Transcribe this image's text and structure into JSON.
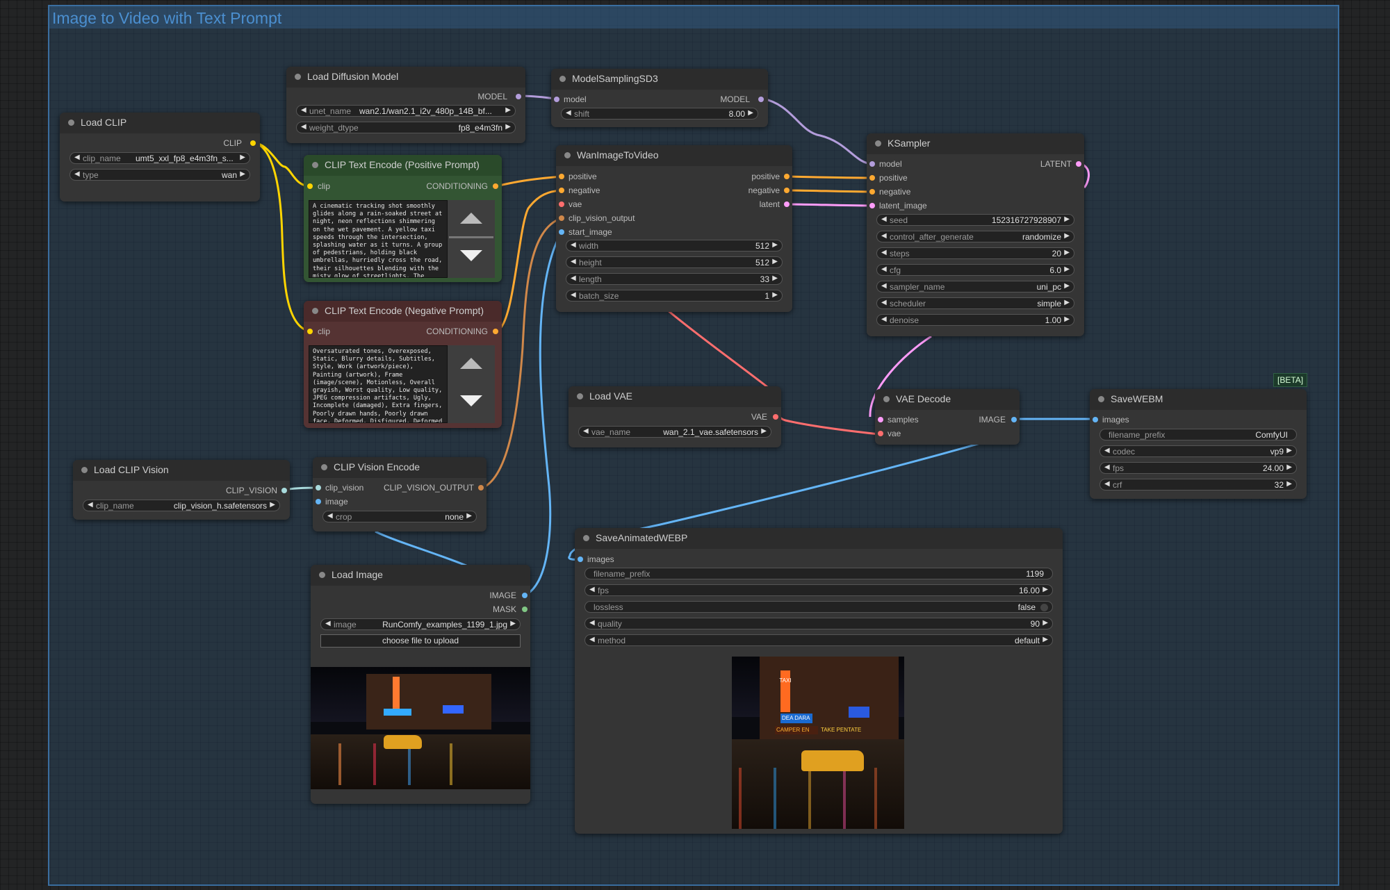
{
  "group": {
    "title": "Image to Video with Text Prompt"
  },
  "nodes": {
    "load_diffusion_model": {
      "title": "Load Diffusion Model",
      "out": "MODEL",
      "widgets": [
        {
          "label": "unet_name",
          "value": "wan2.1/wan2.1_i2v_480p_14B_bf..."
        },
        {
          "label": "weight_dtype",
          "value": "fp8_e4m3fn"
        }
      ]
    },
    "model_sampling": {
      "title": "ModelSamplingSD3",
      "in": "model",
      "out": "MODEL",
      "widgets": [
        {
          "label": "shift",
          "value": "8.00"
        }
      ]
    },
    "load_clip": {
      "title": "Load CLIP",
      "out": "CLIP",
      "widgets": [
        {
          "label": "clip_name",
          "value": "umt5_xxl_fp8_e4m3fn_s..."
        },
        {
          "label": "type",
          "value": "wan"
        }
      ]
    },
    "clip_pos": {
      "title": "CLIP Text Encode (Positive Prompt)",
      "in": "clip",
      "out": "CONDITIONING",
      "text": "A cinematic tracking shot smoothly glides along a rain-soaked street at night, neon reflections shimmering on the wet pavement. A yellow taxi speeds through the intersection, splashing water as it turns. A group of pedestrians, holding black umbrellas, hurriedly cross the road, their silhouettes blending with the misty glow of streetlights. The camera"
    },
    "clip_neg": {
      "title": "CLIP Text Encode (Negative Prompt)",
      "in": "clip",
      "out": "CONDITIONING",
      "text": "Oversaturated tones, Overexposed, Static, Blurry details, Subtitles, Style, Work (artwork/piece), Painting (artwork), Frame (image/scene), Motionless, Overall grayish, Worst quality, Low quality, JPEG compression artifacts, Ugly, Incomplete (damaged), Extra fingers, Poorly drawn hands, Poorly drawn face, Deformed, Disfigured, Deformed limbs, Fused"
    },
    "wan_i2v": {
      "title": "WanImageToVideo",
      "inputs": [
        "positive",
        "negative",
        "vae",
        "clip_vision_output",
        "start_image"
      ],
      "outputs": [
        "positive",
        "negative",
        "latent"
      ],
      "widgets": [
        {
          "label": "width",
          "value": "512"
        },
        {
          "label": "height",
          "value": "512"
        },
        {
          "label": "length",
          "value": "33"
        },
        {
          "label": "batch_size",
          "value": "1"
        }
      ]
    },
    "ksampler": {
      "title": "KSampler",
      "inputs": [
        "model",
        "positive",
        "negative",
        "latent_image"
      ],
      "out": "LATENT",
      "widgets": [
        {
          "label": "seed",
          "value": "152316727928907"
        },
        {
          "label": "control_after_generate",
          "value": "randomize"
        },
        {
          "label": "steps",
          "value": "20"
        },
        {
          "label": "cfg",
          "value": "6.0"
        },
        {
          "label": "sampler_name",
          "value": "uni_pc"
        },
        {
          "label": "scheduler",
          "value": "simple"
        },
        {
          "label": "denoise",
          "value": "1.00"
        }
      ]
    },
    "load_vae": {
      "title": "Load VAE",
      "out": "VAE",
      "widgets": [
        {
          "label": "vae_name",
          "value": "wan_2.1_vae.safetensors"
        }
      ]
    },
    "vae_decode": {
      "title": "VAE Decode",
      "inputs": [
        "samples",
        "vae"
      ],
      "out": "IMAGE"
    },
    "save_webm": {
      "title": "SaveWEBM",
      "badge": "[BETA]",
      "in": "images",
      "widgets": [
        {
          "label": "filename_prefix",
          "value": "ComfyUI"
        },
        {
          "label": "codec",
          "value": "vp9"
        },
        {
          "label": "fps",
          "value": "24.00"
        },
        {
          "label": "crf",
          "value": "32"
        }
      ]
    },
    "load_clip_vision": {
      "title": "Load CLIP Vision",
      "out": "CLIP_VISION",
      "widgets": [
        {
          "label": "clip_name",
          "value": "clip_vision_h.safetensors"
        }
      ]
    },
    "clip_vision_encode": {
      "title": "CLIP Vision Encode",
      "inputs": [
        "clip_vision",
        "image"
      ],
      "out": "CLIP_VISION_OUTPUT",
      "widgets": [
        {
          "label": "crop",
          "value": "none"
        }
      ]
    },
    "load_image": {
      "title": "Load Image",
      "outputs": [
        "IMAGE",
        "MASK"
      ],
      "widgets": [
        {
          "label": "image",
          "value": "RunComfy_examples_1199_1.jpg"
        }
      ],
      "upload": "choose file to upload"
    },
    "save_anim_webp": {
      "title": "SaveAnimatedWEBP",
      "in": "images",
      "widgets": [
        {
          "label": "filename_prefix",
          "value": "1199"
        },
        {
          "label": "fps",
          "value": "16.00"
        },
        {
          "label": "lossless",
          "value": "false"
        },
        {
          "label": "quality",
          "value": "90"
        },
        {
          "label": "method",
          "value": "default"
        }
      ]
    }
  },
  "photo_signs": {
    "a": "TAXI",
    "b": "DEA DARA",
    "c": "CAMPER EN",
    "d": "TAKE PENTATE"
  },
  "colors": {
    "model": "#b39ddb",
    "clip": "#ffd500",
    "conditioning": "#ffa931",
    "vae": "#ff6e6e",
    "image": "#64b5f6",
    "latent": "#ff9cf9",
    "clip_vision": "#a8dadc",
    "mask": "#81c784"
  }
}
